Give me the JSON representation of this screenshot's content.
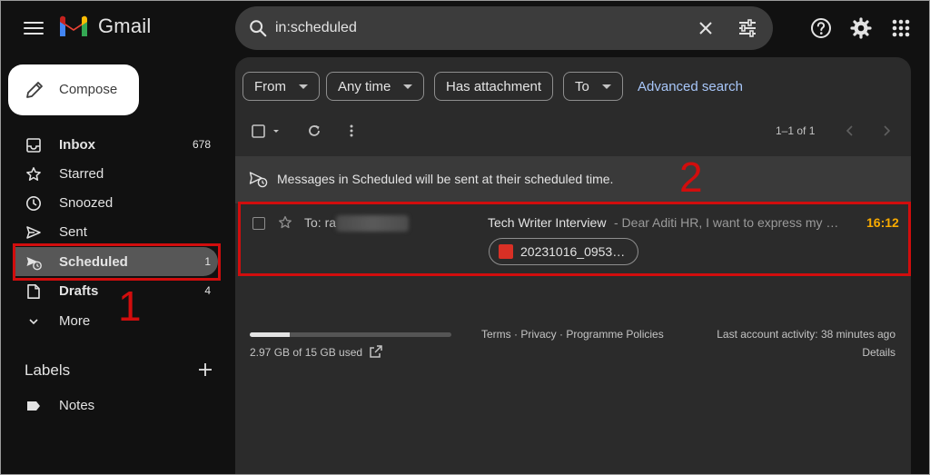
{
  "header": {
    "brand": "Gmail",
    "search_value": "in:scheduled"
  },
  "sidebar": {
    "compose_label": "Compose",
    "items": [
      {
        "label": "Inbox",
        "count": "678",
        "icon": "inbox-icon"
      },
      {
        "label": "Starred",
        "count": "",
        "icon": "star-icon"
      },
      {
        "label": "Snoozed",
        "count": "",
        "icon": "clock-icon"
      },
      {
        "label": "Sent",
        "count": "",
        "icon": "send-icon"
      },
      {
        "label": "Scheduled",
        "count": "1",
        "icon": "scheduled-send-icon"
      },
      {
        "label": "Drafts",
        "count": "4",
        "icon": "draft-icon"
      },
      {
        "label": "More",
        "count": "",
        "icon": "chevron-down-icon"
      }
    ],
    "labels_heading": "Labels",
    "labels": [
      {
        "label": "Notes",
        "icon": "label-icon"
      }
    ]
  },
  "filters": {
    "chips": [
      "From",
      "Any time",
      "Has attachment",
      "To"
    ],
    "advanced": "Advanced search"
  },
  "toolbar": {
    "pager": "1–1 of 1"
  },
  "banner": {
    "text": "Messages in Scheduled will be sent at their scheduled time."
  },
  "messages": [
    {
      "to": "To: ra",
      "subject": "Tech Writer Interview",
      "snippet": "- Dear Aditi HR, I want to express my …",
      "time": "16:12",
      "attachment": "20231016_0953…"
    }
  ],
  "footer": {
    "storage_text": "2.97 GB of 15 GB used",
    "storage_fraction": 0.198,
    "links": "Terms · Privacy · Programme Policies",
    "last_activity": "Last account activity: 38 minutes ago",
    "details": "Details"
  },
  "annotations": {
    "one": "1",
    "two": "2"
  },
  "colors": {
    "accent_time": "#f9ab00",
    "annotation": "#d10d0d",
    "link": "#a8c7fa"
  }
}
